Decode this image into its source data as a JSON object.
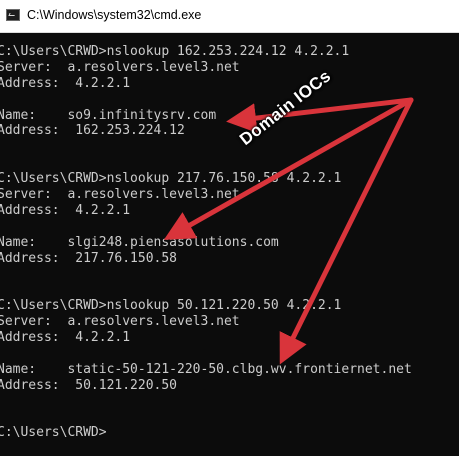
{
  "window": {
    "title": "C:\\Windows\\system32\\cmd.exe",
    "icon": "cmd-console-icon"
  },
  "console": {
    "lines": [
      "C:\\Users\\CRWD>nslookup 162.253.224.12 4.2.2.1",
      "Server:  a.resolvers.level3.net",
      "Address:  4.2.2.1",
      "",
      "Name:    so9.infinitysrv.com",
      "Address:  162.253.224.12",
      "",
      "",
      "C:\\Users\\CRWD>nslookup 217.76.150.58 4.2.2.1",
      "Server:  a.resolvers.level3.net",
      "Address:  4.2.2.1",
      "",
      "Name:    slgi248.piensasolutions.com",
      "Address:  217.76.150.58",
      "",
      "",
      "C:\\Users\\CRWD>nslookup 50.121.220.50 4.2.2.1",
      "Server:  a.resolvers.level3.net",
      "Address:  4.2.2.1",
      "",
      "Name:    static-50-121-220-50.clbg.wv.frontiernet.net",
      "Address:  50.121.220.50",
      "",
      "",
      "C:\\Users\\CRWD>"
    ]
  },
  "annotation": {
    "label": "Domain IOCs",
    "arrow_color": "#d9343b",
    "text_color": "#ffffff"
  },
  "colors": {
    "console_bg": "#0c0c0c",
    "console_fg": "#cccccc",
    "titlebar_bg": "#ffffff"
  }
}
